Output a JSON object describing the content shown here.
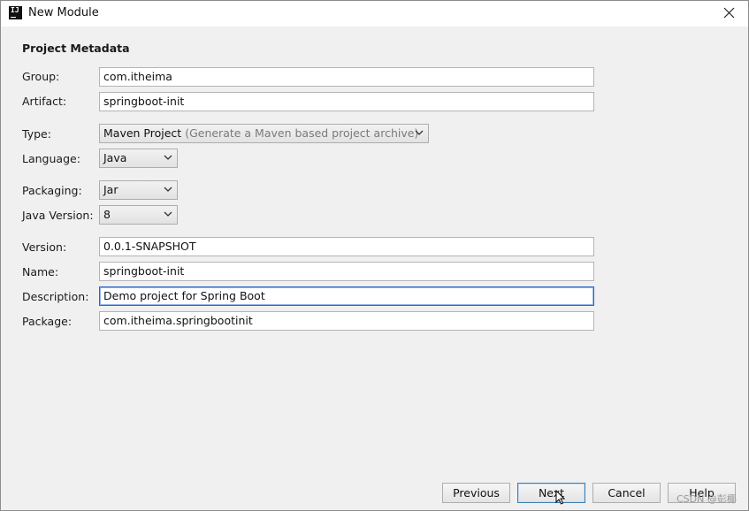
{
  "window": {
    "title": "New Module"
  },
  "section": {
    "title": "Project Metadata"
  },
  "form": {
    "group": {
      "label": "Group:",
      "value": "com.itheima"
    },
    "artifact": {
      "label": "Artifact:",
      "value": "springboot-init"
    },
    "type": {
      "label": "Type:",
      "value": "Maven Project",
      "hint": "(Generate a Maven based project archive)"
    },
    "language": {
      "label": "Language:",
      "value": "Java"
    },
    "packaging": {
      "label": "Packaging:",
      "value": "Jar"
    },
    "java_version": {
      "label": "Java Version:",
      "value": "8"
    },
    "version": {
      "label": "Version:",
      "value": "0.0.1-SNAPSHOT"
    },
    "name": {
      "label": "Name:",
      "value": "springboot-init"
    },
    "description": {
      "label": "Description:",
      "value": "Demo project for Spring Boot"
    },
    "package": {
      "label": "Package:",
      "value": "com.itheima.springbootinit"
    }
  },
  "buttons": {
    "previous": "Previous",
    "next": "Next",
    "cancel": "Cancel",
    "help": "Help"
  },
  "watermark": "CSDN @彭椰",
  "icons": {
    "app": "intellij-idea-icon",
    "close": "close-icon",
    "dropdown": "chevron-down-icon",
    "cursor": "mouse-pointer-icon"
  }
}
